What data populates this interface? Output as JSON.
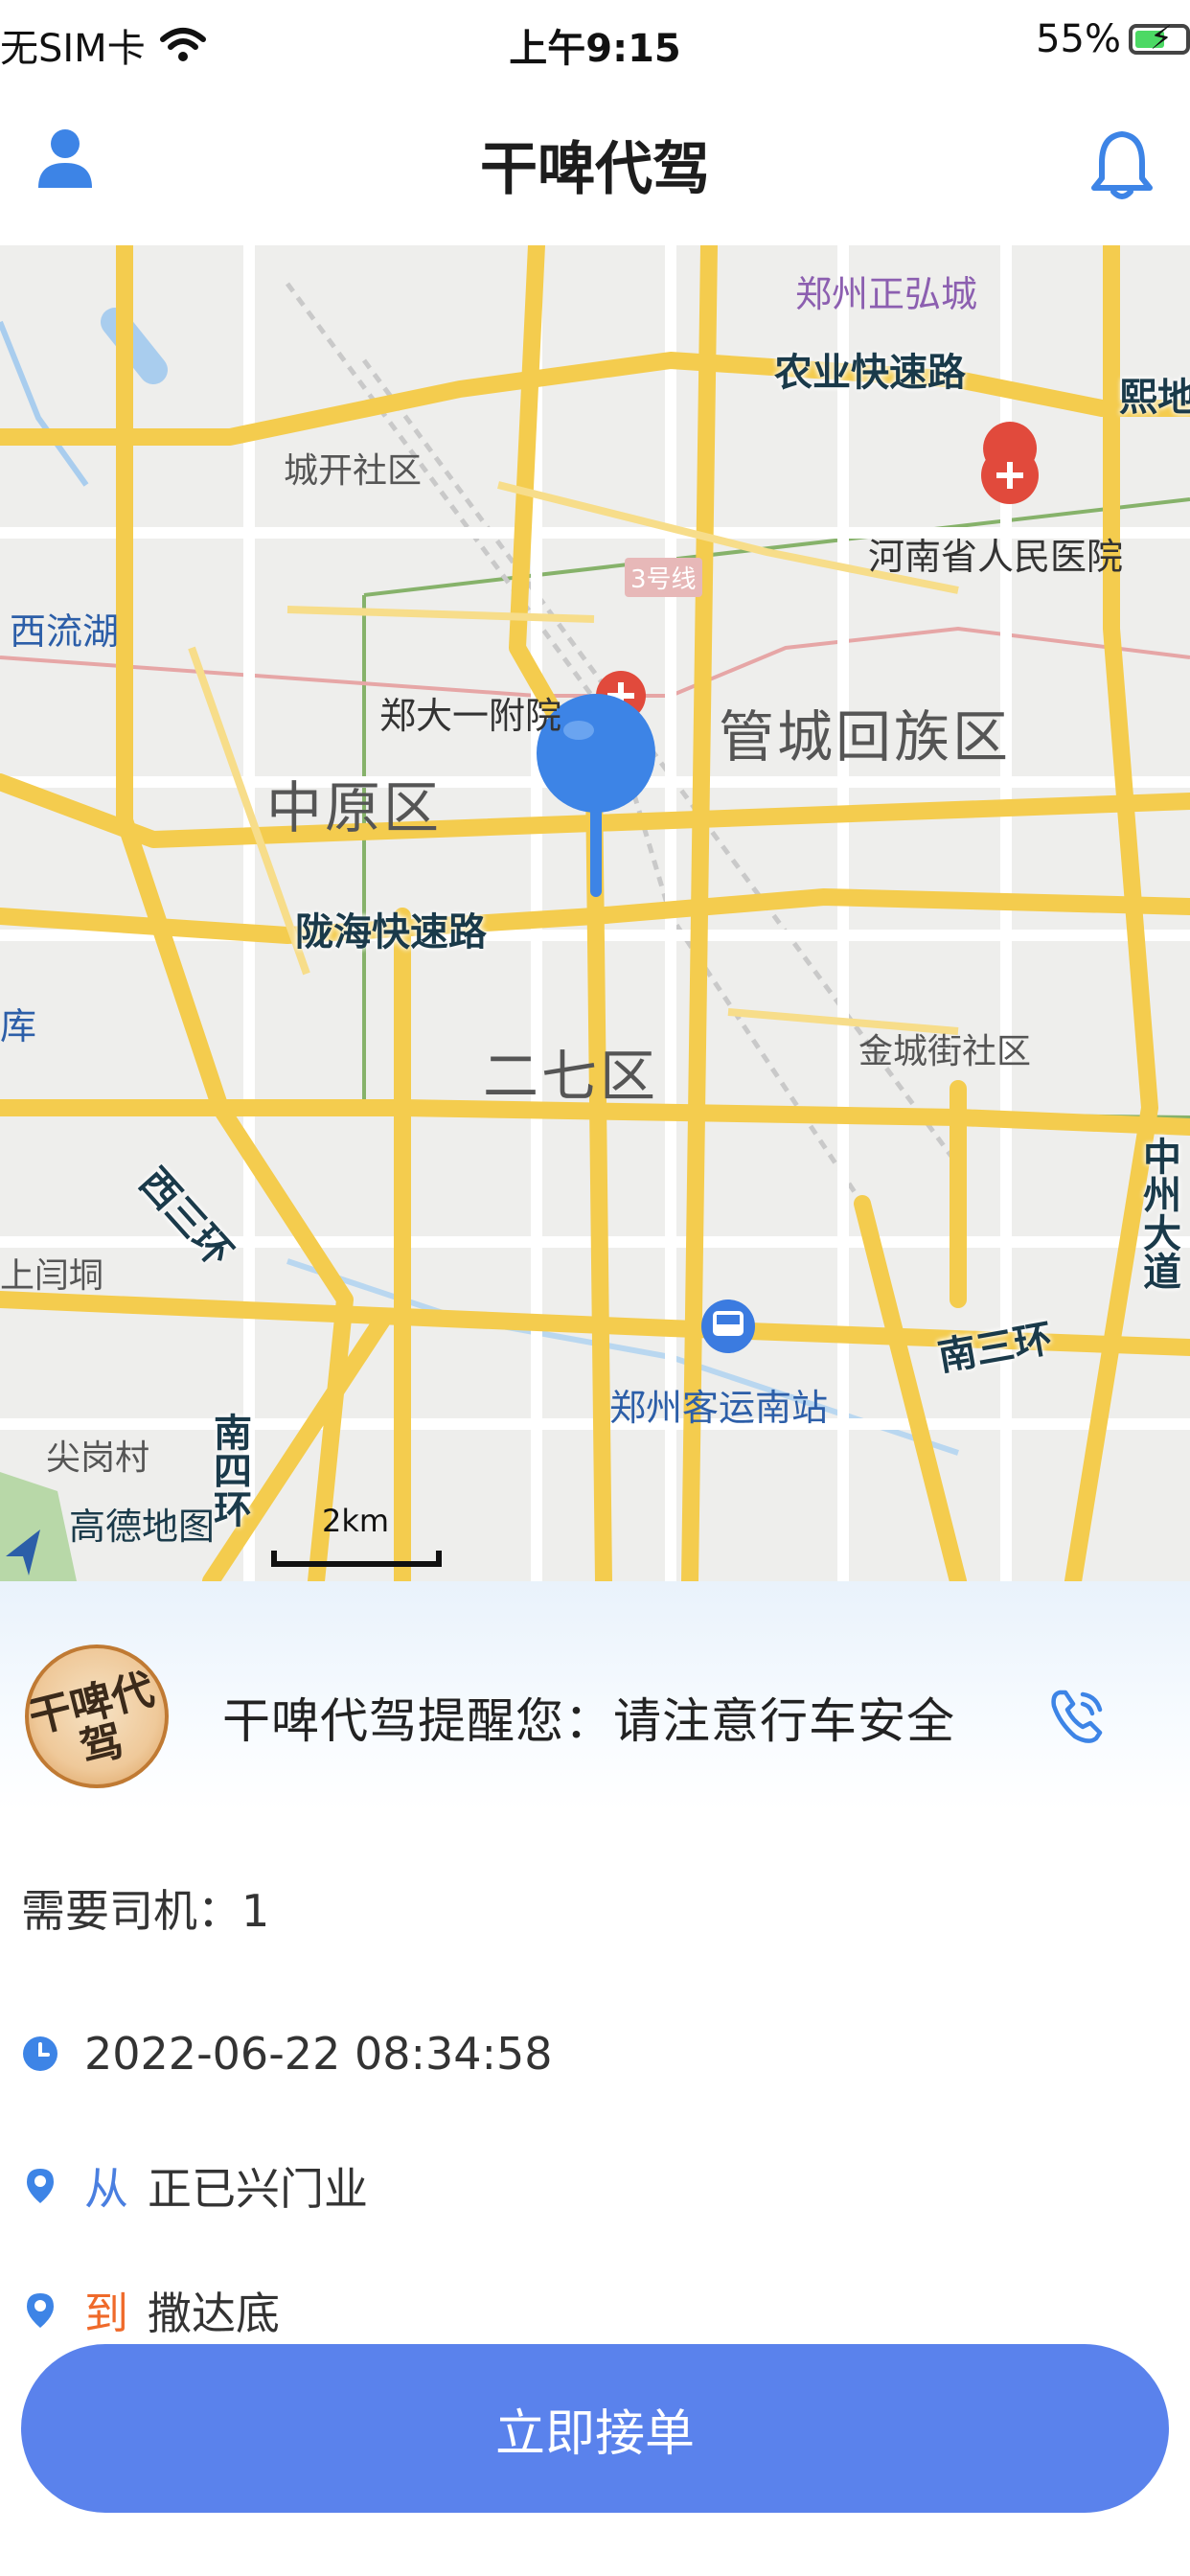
{
  "status_bar": {
    "carrier": "无SIM卡",
    "time": "上午9:15",
    "battery": "55%"
  },
  "header": {
    "title": "干啤代驾"
  },
  "map": {
    "labels": {
      "zhengzhou_zhenghong": "郑州正弘城",
      "nongye_road": "农业快速路",
      "xi_di": "熙地",
      "chengkai": "城开社区",
      "henan_hospital": "河南省人民医院",
      "line3": "3号线",
      "xiliuhu": "西流湖",
      "zhengda_hospital": "郑大一附院",
      "guancheng": "管城回族区",
      "zhongyuan": "中原区",
      "longhai": "陇海快速路",
      "ku": "库",
      "erqi": "二七区",
      "jinchengjie": "金城街社区",
      "xisanhuan": "西三环",
      "zhongzhou_ave": "中州大道",
      "shangtong": "上闫垌",
      "nansanhuan": "南三环",
      "keyun_south": "郑州客运南站",
      "jiangangcun": "尖岗村",
      "nansihuan": "南四环",
      "gaode": "高德地图",
      "scale": "2km"
    }
  },
  "reminder": {
    "text": "干啤代驾提醒您：请注意行车安全",
    "logo_text": "干啤代驾"
  },
  "order": {
    "drivers_needed": "需要司机：1",
    "time": "2022-06-22 08:34:58",
    "from_label": "从",
    "from_address": "正已兴门业",
    "to_label": "到",
    "to_address": "撒达底"
  },
  "action": {
    "accept_label": "立即接单"
  },
  "colors": {
    "accent": "#5a82ec",
    "map_pin": "#3d84e6",
    "from": "#4a7fe0",
    "to": "#ef6a2a",
    "road_main": "#f4cc4e"
  }
}
